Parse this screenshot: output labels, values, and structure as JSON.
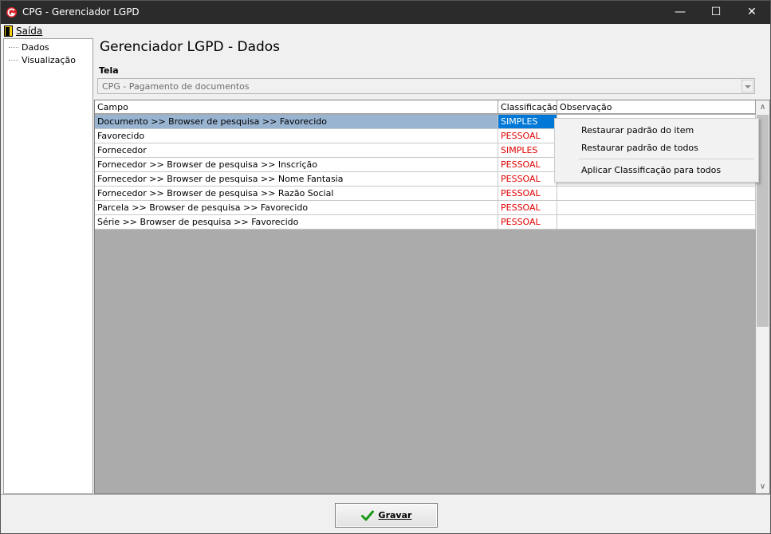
{
  "window": {
    "title": "CPG - Gerenciador LGPD",
    "minimize_glyph": "—",
    "maximize_glyph": "☐",
    "close_glyph": "✕"
  },
  "menu": {
    "saida": "Saída"
  },
  "tree": {
    "items": [
      "Dados",
      "Visualização"
    ]
  },
  "page": {
    "heading": "Gerenciador LGPD - Dados",
    "tela_label": "Tela",
    "tela_value": "CPG - Pagamento de documentos"
  },
  "grid": {
    "columns": [
      "Campo",
      "Classificação",
      "Observação"
    ],
    "rows": [
      {
        "campo": "Documento >> Browser de pesquisa >> Favorecido",
        "classificacao": "SIMPLES",
        "observacao": ""
      },
      {
        "campo": "Favorecido",
        "classificacao": "PESSOAL",
        "observacao": ""
      },
      {
        "campo": "Fornecedor",
        "classificacao": "SIMPLES",
        "observacao": ""
      },
      {
        "campo": "Fornecedor >> Browser de pesquisa >> Inscrição",
        "classificacao": "PESSOAL",
        "observacao": ""
      },
      {
        "campo": "Fornecedor >> Browser de pesquisa >> Nome Fantasia",
        "classificacao": "PESSOAL",
        "observacao": ""
      },
      {
        "campo": "Fornecedor >> Browser de pesquisa >> Razão Social",
        "classificacao": "PESSOAL",
        "observacao": ""
      },
      {
        "campo": "Parcela >> Browser de pesquisa >> Favorecido",
        "classificacao": "PESSOAL",
        "observacao": ""
      },
      {
        "campo": "Série >> Browser de pesquisa >> Favorecido",
        "classificacao": "PESSOAL",
        "observacao": ""
      }
    ],
    "scroll_up": "∧",
    "scroll_down": "∨"
  },
  "context_menu": {
    "items": [
      "Restaurar padrão do item",
      "Restaurar padrão de todos",
      "Aplicar Classificação para todos"
    ]
  },
  "footer": {
    "gravar": "Gravar"
  },
  "colors": {
    "titlebar": "#2b2b2b",
    "selection": "#0078d7",
    "row_highlight": "#99b4d1",
    "pessoal_text": "#e00000",
    "logo_red": "#d9222a"
  },
  "icons": [
    "app-logo-icon",
    "exit-door-icon",
    "green-check-icon"
  ]
}
